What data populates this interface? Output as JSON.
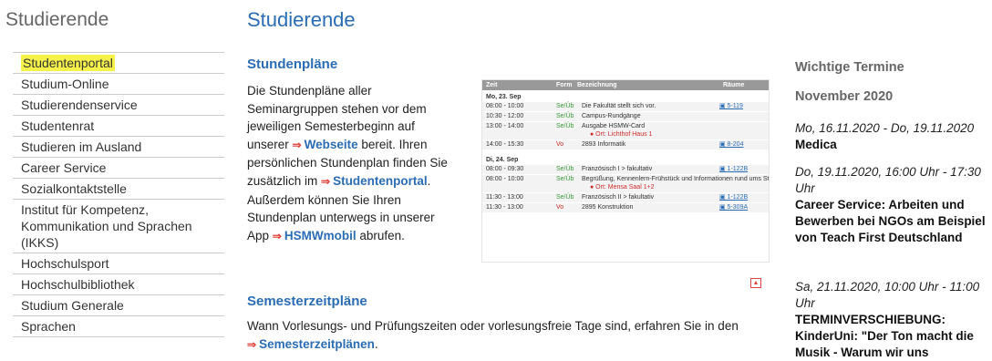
{
  "sidebar": {
    "title": "Studierende",
    "items": [
      "Studentenportal",
      "Studium-Online",
      "Studierendenservice",
      "Studentenrat",
      "Studieren im Ausland",
      "Career Service",
      "Sozialkontaktstelle",
      "Institut für Kompetenz, Kommunikation und Sprachen (IKKS)",
      "Hochschulsport",
      "Hochschulbibliothek",
      "Studium Generale",
      "Sprachen"
    ]
  },
  "main": {
    "title": "Studierende",
    "stundenplaene": {
      "heading": "Stundenpläne",
      "t1": "Die Stundenpläne aller Seminargruppen stehen vor dem jeweiligen Semesterbeginn auf unserer",
      "link1": "Webseite",
      "t2": "bereit. Ihren persönlichen Stundenplan finden Sie zusätzlich im",
      "link2": "Studentenportal",
      "t3": ". Außerdem können Sie Ihren Stundenplan unterwegs in unserer App",
      "link3": "HSMWmobil",
      "t4": "abrufen."
    },
    "timetable": {
      "headers": {
        "zeit": "Zeit",
        "form": "Form",
        "bez": "Bezeichnung",
        "raum": "Räume"
      },
      "day1": "Mo, 23. Sep",
      "day2": "Di, 24. Sep",
      "rows1": [
        {
          "zeit": "08:00 - 10:00",
          "form": "Se/Üb",
          "bez": "Die Fakultät stellt sich vor.",
          "raum": "5-119"
        },
        {
          "zeit": "10:30 - 12:00",
          "form": "Se/Üb",
          "bez": "Campus-Rundgänge",
          "raum": ""
        },
        {
          "zeit": "13:00 - 14:00",
          "form": "Se/Üb",
          "bez": "Ausgabe HSMW-Card",
          "note": "Ort: Lichthof Haus 1",
          "raum": ""
        },
        {
          "zeit": "14:00 - 15:30",
          "form": "Vo",
          "bez": "2893 Informatik",
          "raum": "8-204"
        }
      ],
      "rows2": [
        {
          "zeit": "08:00 - 09:30",
          "form": "Se/Üb",
          "bez": "Französisch I > fakultativ",
          "raum": "1-122B"
        },
        {
          "zeit": "08:00 - 10:00",
          "form": "Se/Üb",
          "bez": "Begrüßung, Kennenlern-Frühstück und Informationen rund ums Studium",
          "note": "Ort: Mensa Saal 1+2",
          "raum": ""
        },
        {
          "zeit": "11:30 - 13:00",
          "form": "Se/Üb",
          "bez": "Französisch II > fakultativ",
          "raum": "1-122B"
        },
        {
          "zeit": "11:30 - 13:00",
          "form": "Vo",
          "bez": "2895 Konstruktion",
          "raum": "5-309A"
        }
      ]
    },
    "semester": {
      "heading": "Semesterzeitpläne",
      "t1": "Wann Vorlesungs- und Prüfungszeiten oder vorlesungsfreie Tage sind, erfahren Sie in den",
      "link": "Semesterzeitplänen",
      "t2": "."
    }
  },
  "right": {
    "heading": "Wichtige Termine",
    "month": "November 2020",
    "events": [
      {
        "date": "Mo, 16.11.2020 - Do, 19.11.2020",
        "title": "Medica"
      },
      {
        "date": "Do, 19.11.2020, 16:00 Uhr - 17:30 Uhr",
        "title": "Career Service: Arbeiten und Bewerben bei NGOs am Beispiel von Teach First Deutschland"
      },
      {
        "date": "Sa, 21.11.2020, 10:00 Uhr - 11:00 Uhr",
        "title": "TERMINVERSCHIEBUNG: KinderUni: \"Der Ton macht die Musik - Warum wir uns"
      }
    ]
  },
  "colors": {
    "link": "#2a6db5",
    "highlight": "#f6f24a",
    "arrow": "#e0403a"
  }
}
